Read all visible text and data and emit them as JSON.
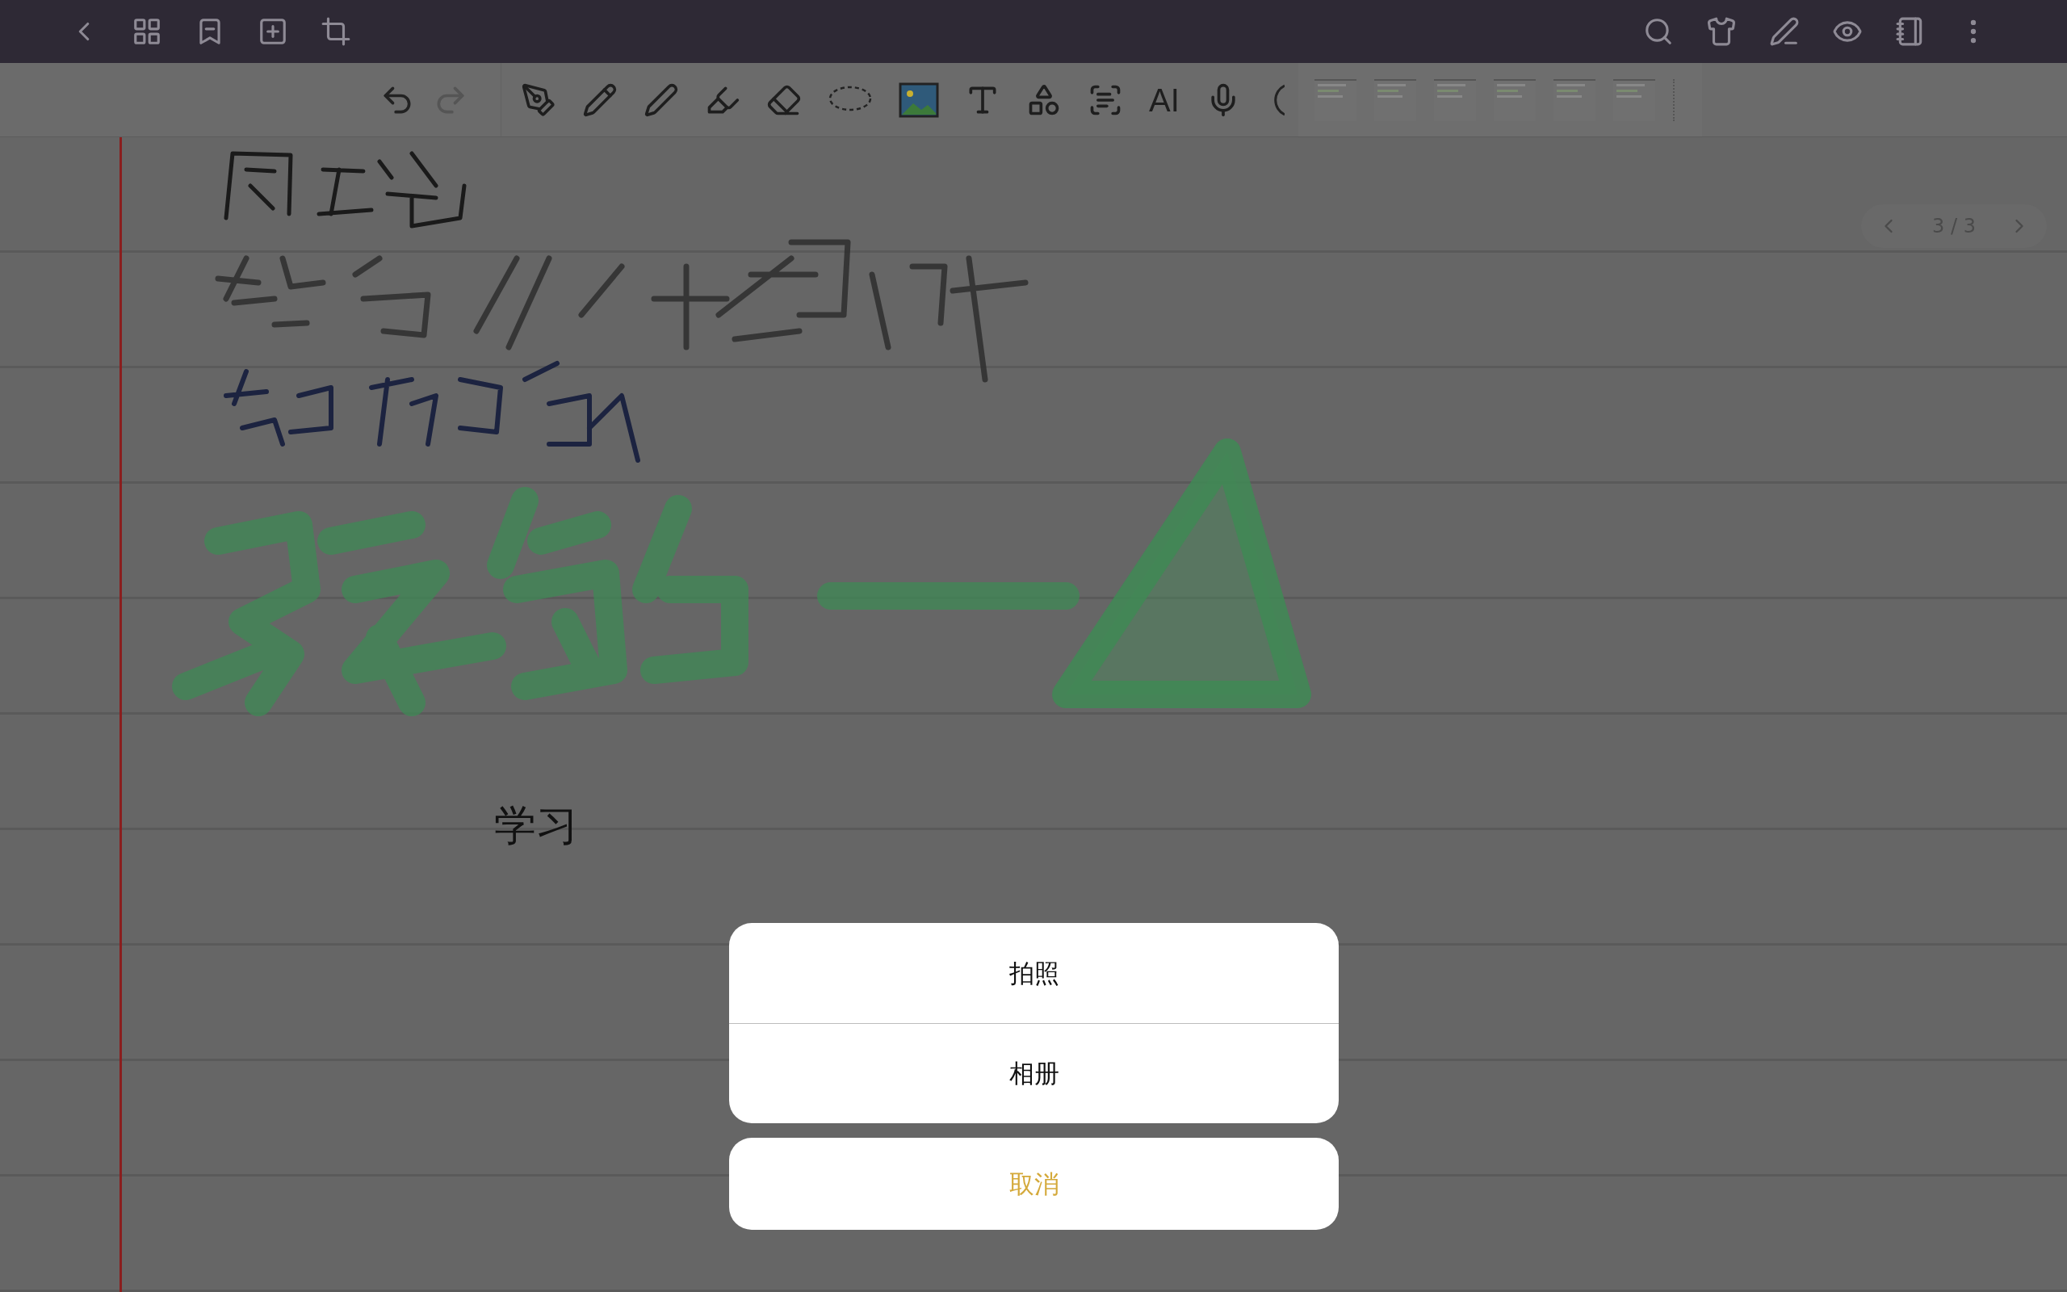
{
  "toolbar": {
    "ai_label": "AI"
  },
  "page_indicator": {
    "text": "3 / 3"
  },
  "note": {
    "typed_text": "学习"
  },
  "action_sheet": {
    "options": [
      "拍照",
      "相册"
    ],
    "cancel": "取消"
  }
}
